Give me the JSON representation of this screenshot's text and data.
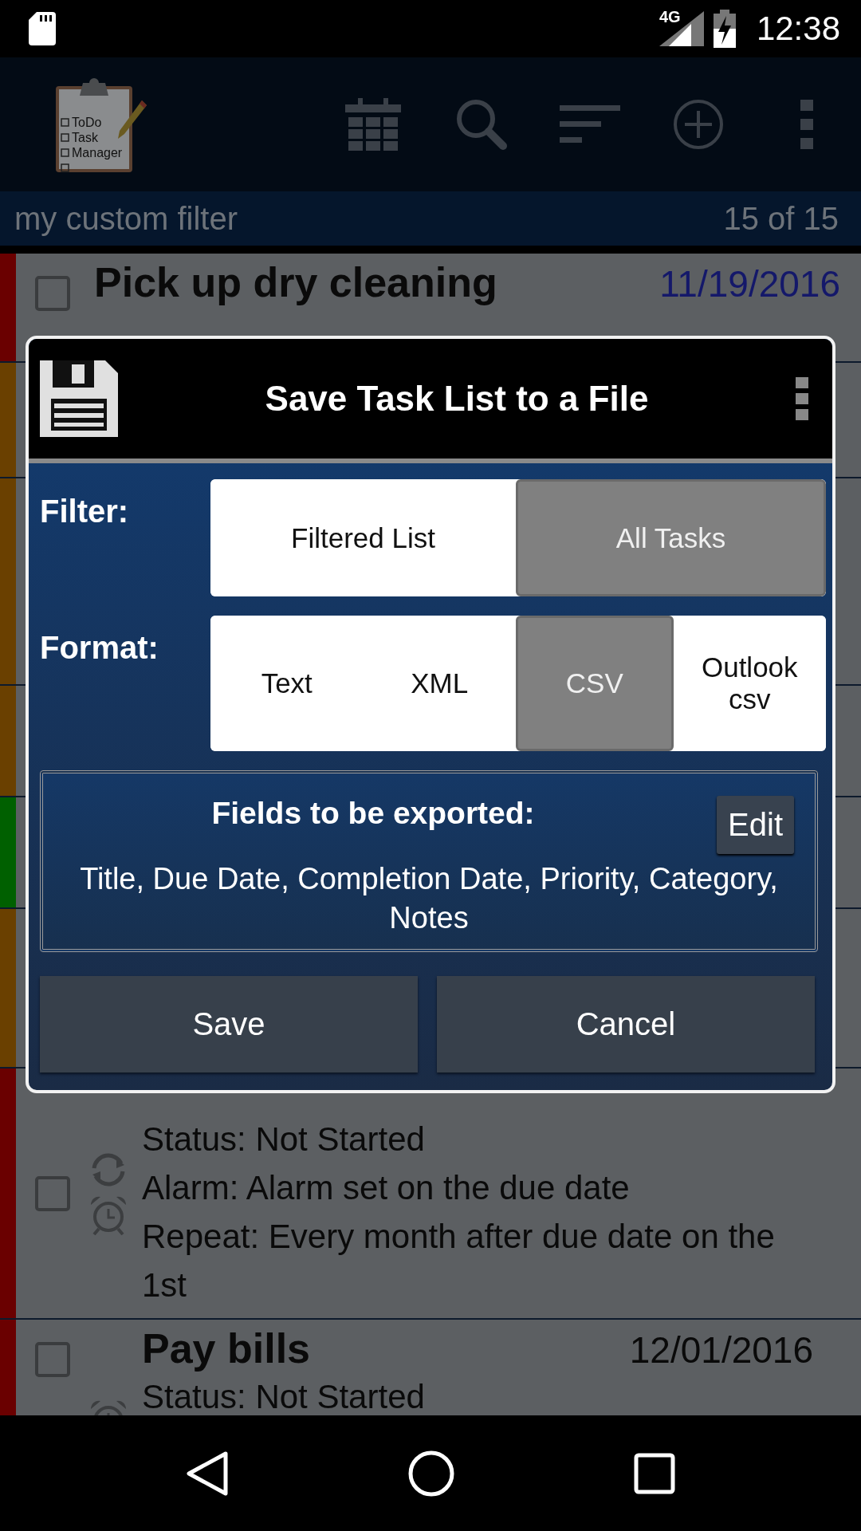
{
  "status_bar": {
    "network": "4G",
    "time": "12:38"
  },
  "app_bar": {
    "logo_lines": [
      "ToDo",
      "Task",
      "Manager"
    ]
  },
  "filter_bar": {
    "name": "my custom filter",
    "count": "15 of 15"
  },
  "tasks": [
    {
      "kind": "task",
      "color": "#6a0000",
      "title": "Pick up dry cleaning",
      "date": "11/19/2016",
      "overdue": true,
      "checked": false
    },
    {
      "kind": "covered",
      "color": "#6a4000"
    },
    {
      "kind": "covered",
      "color": "#6a4000"
    },
    {
      "kind": "covered",
      "color": "#6a4000"
    },
    {
      "kind": "covered",
      "color": "#006000"
    },
    {
      "kind": "covered",
      "color": "#6a4000"
    },
    {
      "kind": "task",
      "color": "#6a0000",
      "checked": false,
      "repeat": true,
      "alarm": true,
      "details": [
        "Status: Not Started",
        "Alarm: Alarm set on the due date",
        "Repeat: Every month after due date on the 1st"
      ]
    },
    {
      "kind": "task",
      "color": "#6a0000",
      "title": "Pay bills",
      "date": "12/01/2016",
      "overdue": false,
      "checked": false,
      "alarm": true,
      "details": [
        "Status: Not Started"
      ]
    }
  ],
  "dialog": {
    "title": "Save Task List to a File",
    "filter": {
      "label": "Filter:",
      "options": [
        {
          "label": "Filtered List",
          "selected": false
        },
        {
          "label": "All Tasks",
          "selected": true
        }
      ]
    },
    "format": {
      "label": "Format:",
      "options": [
        {
          "label": "Text",
          "selected": false
        },
        {
          "label": "XML",
          "selected": false
        },
        {
          "label": "CSV",
          "selected": true
        },
        {
          "label": "Outlook csv",
          "selected": false
        }
      ]
    },
    "fields": {
      "heading": "Fields to be exported:",
      "edit": "Edit",
      "list": "Title, Due Date, Completion Date, Priority, Category, Notes"
    },
    "buttons": [
      "Save",
      "Cancel"
    ]
  }
}
